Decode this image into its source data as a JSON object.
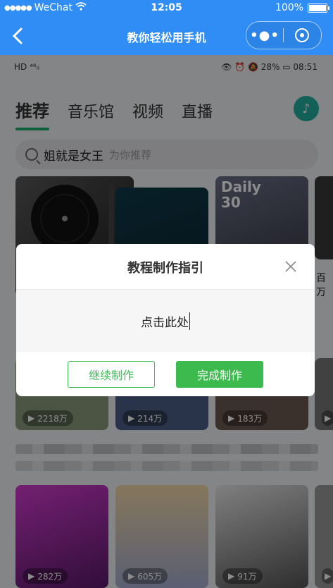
{
  "wechat_status": {
    "carrier": "WeChat",
    "time": "12:05",
    "battery": "100%"
  },
  "nav": {
    "back_icon": "chevron-left-icon",
    "title": "教你轻松用手机",
    "more_icon": "more-dots-icon",
    "close_icon": "target-close-icon"
  },
  "phone_status": {
    "left": "HD ⁴⁶ᵢₗ",
    "right": "👁 ⏰ 🔕 28% ▭ 08:51"
  },
  "tabs": [
    {
      "label": "推荐"
    },
    {
      "label": "音乐馆"
    },
    {
      "label": "视频"
    },
    {
      "label": "直播"
    }
  ],
  "search": {
    "query": "姐就是女王",
    "hint": "为你推荐"
  },
  "cards_top": [
    {
      "label": "Daily 30"
    },
    {
      "label": "百万"
    }
  ],
  "cards_mid": [
    {
      "count": "2218万"
    },
    {
      "count": "214万"
    },
    {
      "count": "183万"
    }
  ],
  "cards_bottom": [
    {
      "count": "282万"
    },
    {
      "count": "605万"
    },
    {
      "count": "91万"
    }
  ],
  "dialog": {
    "title": "教程制作指引",
    "body": "点击此处",
    "continue_label": "继续制作",
    "finish_label": "完成制作"
  },
  "colors": {
    "wechat_blue": "#2f8df5",
    "primary_green": "#3cba4d",
    "qqmusic_green": "#1aad6b"
  }
}
